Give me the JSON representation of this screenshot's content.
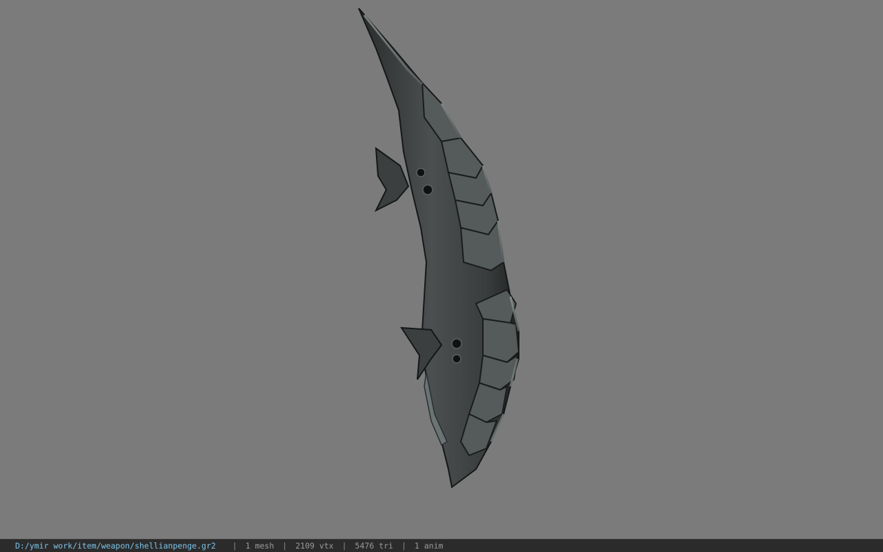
{
  "viewer": {
    "background_color": "#7b7b7b",
    "model_name": "shellianpenge"
  },
  "status": {
    "path": "D:/ymir work/item/weapon/shellianpenge.gr2",
    "separator": "|",
    "mesh": "1 mesh",
    "vtx": "2109 vtx",
    "tri": "5476 tri",
    "anim": "1 anim"
  }
}
